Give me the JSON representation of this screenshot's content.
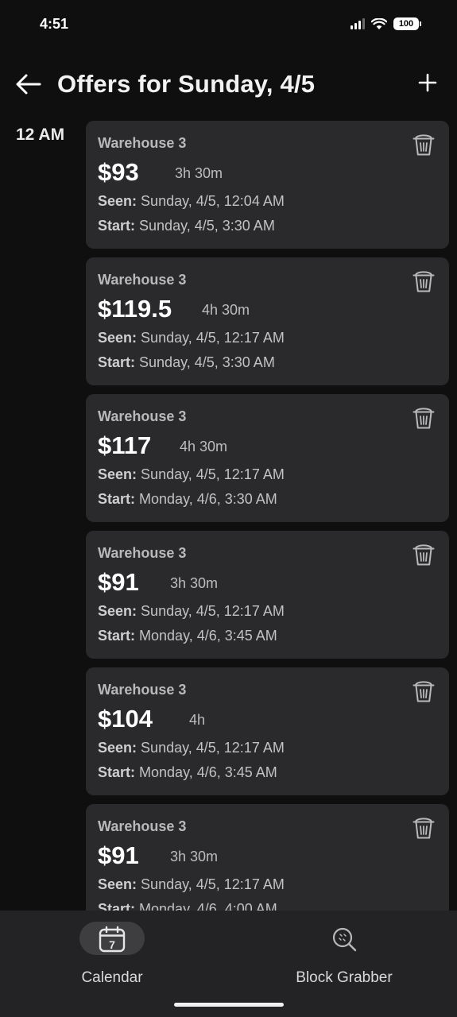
{
  "status_bar": {
    "time": "4:51",
    "battery": "100"
  },
  "header": {
    "title": "Offers for Sunday, 4/5"
  },
  "time_group": "12 AM",
  "labels": {
    "seen": "Seen:",
    "start": "Start:"
  },
  "offers": [
    {
      "location": "Warehouse 3",
      "price": "$93",
      "duration": "3h 30m",
      "seen": "Sunday, 4/5, 12:04 AM",
      "start": "Sunday, 4/5, 3:30 AM"
    },
    {
      "location": "Warehouse 3",
      "price": "$119.5",
      "duration": "4h 30m",
      "seen": "Sunday, 4/5, 12:17 AM",
      "start": "Sunday, 4/5, 3:30 AM"
    },
    {
      "location": "Warehouse 3",
      "price": "$117",
      "duration": "4h 30m",
      "seen": "Sunday, 4/5, 12:17 AM",
      "start": "Monday, 4/6, 3:30 AM"
    },
    {
      "location": "Warehouse 3",
      "price": "$91",
      "duration": "3h 30m",
      "seen": "Sunday, 4/5, 12:17 AM",
      "start": "Monday, 4/6, 3:45 AM"
    },
    {
      "location": "Warehouse 3",
      "price": "$104",
      "duration": "4h",
      "seen": "Sunday, 4/5, 12:17 AM",
      "start": "Monday, 4/6, 3:45 AM"
    },
    {
      "location": "Warehouse 3",
      "price": "$91",
      "duration": "3h 30m",
      "seen": "Sunday, 4/5, 12:17 AM",
      "start": "Monday, 4/6, 4:00 AM"
    }
  ],
  "bottom_nav": {
    "items": [
      {
        "label": "Calendar",
        "icon": "calendar-icon",
        "calendar_day": "7",
        "active": true
      },
      {
        "label": "Block Grabber",
        "icon": "block-grabber-icon",
        "active": false
      }
    ]
  },
  "colors": {
    "background": "#0f0f10",
    "card": "#2a2a2c",
    "nav_background": "#232325",
    "active_pill": "#3e3e41"
  }
}
